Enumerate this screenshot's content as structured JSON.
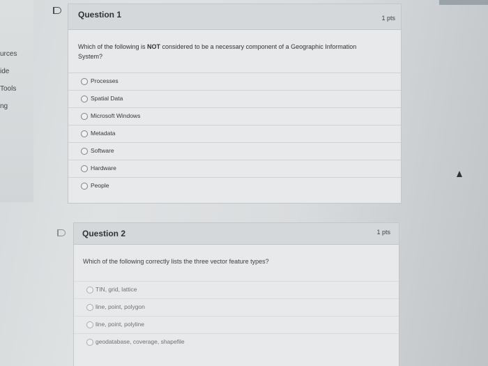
{
  "sidebar": {
    "items": [
      {
        "label": "urces"
      },
      {
        "label": "ide"
      },
      {
        "label": "Tools"
      },
      {
        "label": "ng"
      }
    ]
  },
  "questions": [
    {
      "title": "Question 1",
      "points": "1 pts",
      "text_before": "Which of the following is ",
      "text_emphasis": "NOT",
      "text_after": " considered to be a necessary component of a Geographic Information System?",
      "answers": [
        {
          "label": "Processes"
        },
        {
          "label": "Spatial Data"
        },
        {
          "label": "Microsoft Windows"
        },
        {
          "label": "Metadata"
        },
        {
          "label": "Software"
        },
        {
          "label": "Hardware"
        },
        {
          "label": "People"
        }
      ]
    },
    {
      "title": "Question 2",
      "points": "1 pts",
      "text": "Which of the following correctly lists the three vector feature types?",
      "answers": [
        {
          "label": "TIN, grid, lattice"
        },
        {
          "label": "line, point, polygon"
        },
        {
          "label": "line, point, polyline"
        },
        {
          "label": "geodatabase, coverage, shapefile"
        }
      ]
    }
  ]
}
